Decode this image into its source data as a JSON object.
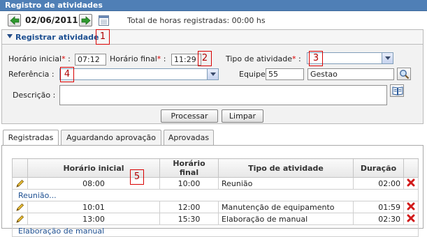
{
  "window": {
    "title": "Registro de atividades"
  },
  "datebar": {
    "prev_icon": "arrow-left-icon",
    "next_icon": "arrow-right-icon",
    "date": "02/06/2011",
    "calendar_icon": "calendar-icon",
    "total": "Total de horas registradas: 00:00 hs"
  },
  "form": {
    "section_title": "Registrar atividade",
    "start_label": "Horário inicial",
    "start_value": "07:12",
    "end_label": "Horário final",
    "end_value": "11:29",
    "activity_type_label": "Tipo de atividade",
    "activity_type_value": "",
    "reference_label": "Referência :",
    "reference_value": "",
    "team_label": "Equipe :",
    "team_code": "55",
    "team_name": "Gestao",
    "description_label": "Descrição :",
    "description_value": "",
    "required_marker": "*",
    "colon": ":",
    "process_button": "Processar",
    "clear_button": "Limpar",
    "search_icon": "magnifier-icon",
    "book_icon": "book-icon"
  },
  "callouts": [
    "1",
    "2",
    "3",
    "4",
    "5"
  ],
  "tabs": [
    {
      "label": "Registradas",
      "active": true
    },
    {
      "label": "Aguardando aprovação",
      "active": false
    },
    {
      "label": "Aprovadas",
      "active": false
    }
  ],
  "table": {
    "headers": [
      "Horário inicial",
      "Horário final",
      "Tipo de atividade",
      "Duração"
    ],
    "rows": [
      {
        "start": "08:00",
        "end": "10:00",
        "type": "Reunião",
        "duration": "02:00",
        "description": "Reunião..."
      },
      {
        "start": "10:01",
        "end": "12:00",
        "type": "Manutenção de equipamento",
        "duration": "01:59",
        "description": ""
      },
      {
        "start": "13:00",
        "end": "15:30",
        "type": "Elaboração de manual",
        "duration": "02:30",
        "description": "Elaboração de manual"
      }
    ],
    "edit_icon": "pencil-icon",
    "delete_icon": "delete-x-icon"
  },
  "colors": {
    "title_bar": "#4f7fb6",
    "accent": "#1d4f91",
    "callout": "#d80000",
    "delete": "#d11a1a"
  }
}
